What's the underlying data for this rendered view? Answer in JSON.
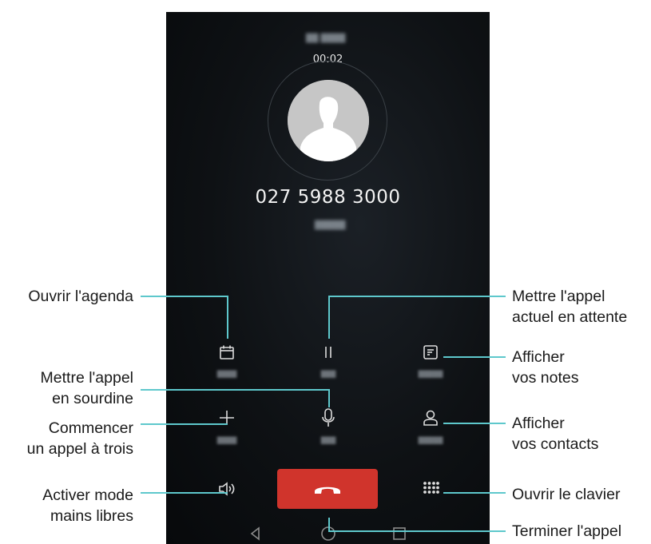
{
  "call": {
    "timer": "00:02",
    "number": "027 5988 3000"
  },
  "buttons": [
    {
      "name": "calendar",
      "icon": "calendar-icon"
    },
    {
      "name": "hold",
      "icon": "pause-icon"
    },
    {
      "name": "notepad",
      "icon": "notepad-icon"
    },
    {
      "name": "add-call",
      "icon": "plus-icon"
    },
    {
      "name": "mute",
      "icon": "microphone-icon"
    },
    {
      "name": "contacts",
      "icon": "person-icon"
    },
    {
      "name": "speaker",
      "icon": "speaker-icon"
    },
    {
      "name": "end-call",
      "icon": "phone-hangup-icon"
    },
    {
      "name": "dialpad",
      "icon": "dialpad-icon"
    }
  ],
  "nav": [
    "back-icon",
    "home-icon",
    "recents-icon"
  ],
  "annotations": {
    "open_calendar": "Ouvrir l'agenda",
    "hold_line1": "Mettre l'appel",
    "hold_line2": "actuel en attente",
    "notes_line1": "Afficher",
    "notes_line2": "vos notes",
    "mute_line1": "Mettre l'appel",
    "mute_line2": "en sourdine",
    "three_way_line1": "Commencer",
    "three_way_line2": "un appel à trois",
    "contacts_line1": "Afficher",
    "contacts_line2": "vos contacts",
    "speaker_line1": "Activer mode",
    "speaker_line2": "mains libres",
    "dialpad": "Ouvrir le clavier",
    "end_call": "Terminer l'appel"
  },
  "colors": {
    "callout_line": "#5ec8cc",
    "end_call_red": "#d0342c",
    "screen_bg": "#0e1114"
  }
}
